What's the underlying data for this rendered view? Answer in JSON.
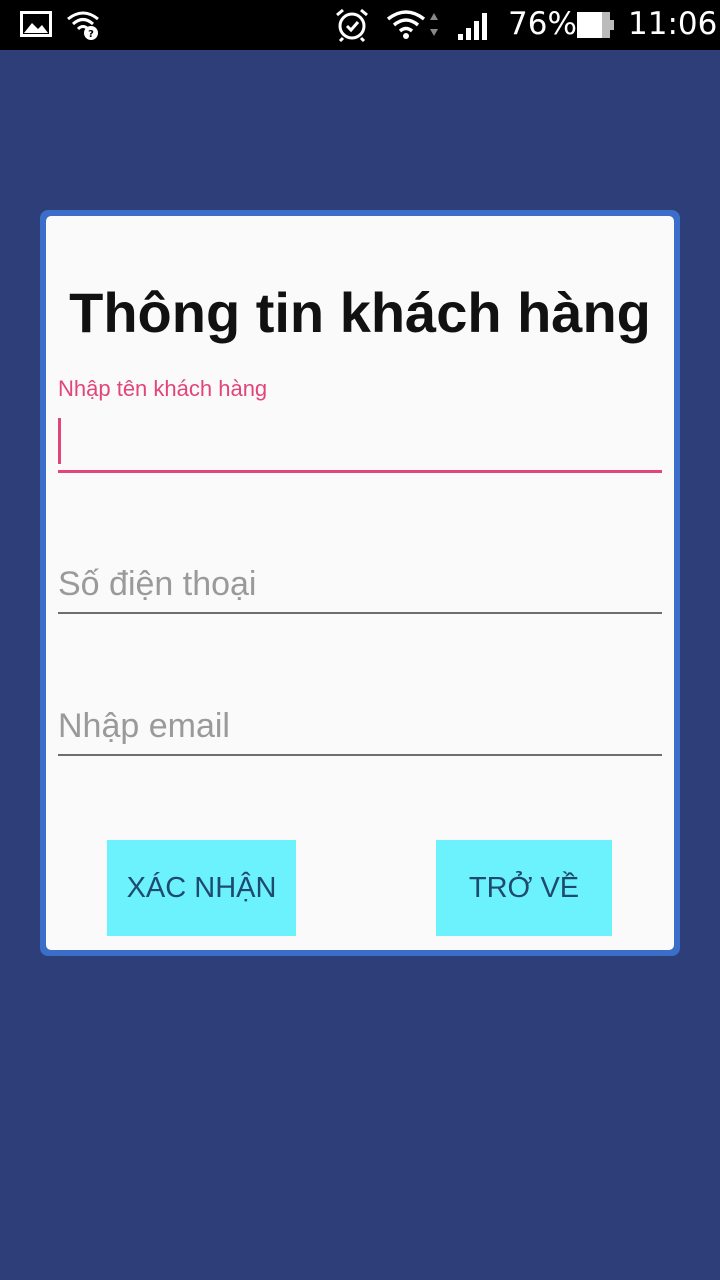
{
  "status_bar": {
    "battery_percent": "76%",
    "time": "11:06",
    "icons": [
      "gallery-icon",
      "wifi-unknown-icon",
      "alarm-icon",
      "wifi-icon",
      "signal-icon",
      "battery-icon"
    ]
  },
  "form": {
    "title": "Thông tin khách hàng",
    "name_label": "Nhập tên khách hàng",
    "name_value": "",
    "phone_placeholder": "Số điện thoại",
    "email_placeholder": "Nhập email",
    "confirm_label": "XÁC NHẬN",
    "back_label": "TRỞ VỀ"
  },
  "colors": {
    "background": "#2e3e78",
    "card_border": "#3a6ec8",
    "accent": "#e2457a",
    "button": "#6cf2fc"
  }
}
